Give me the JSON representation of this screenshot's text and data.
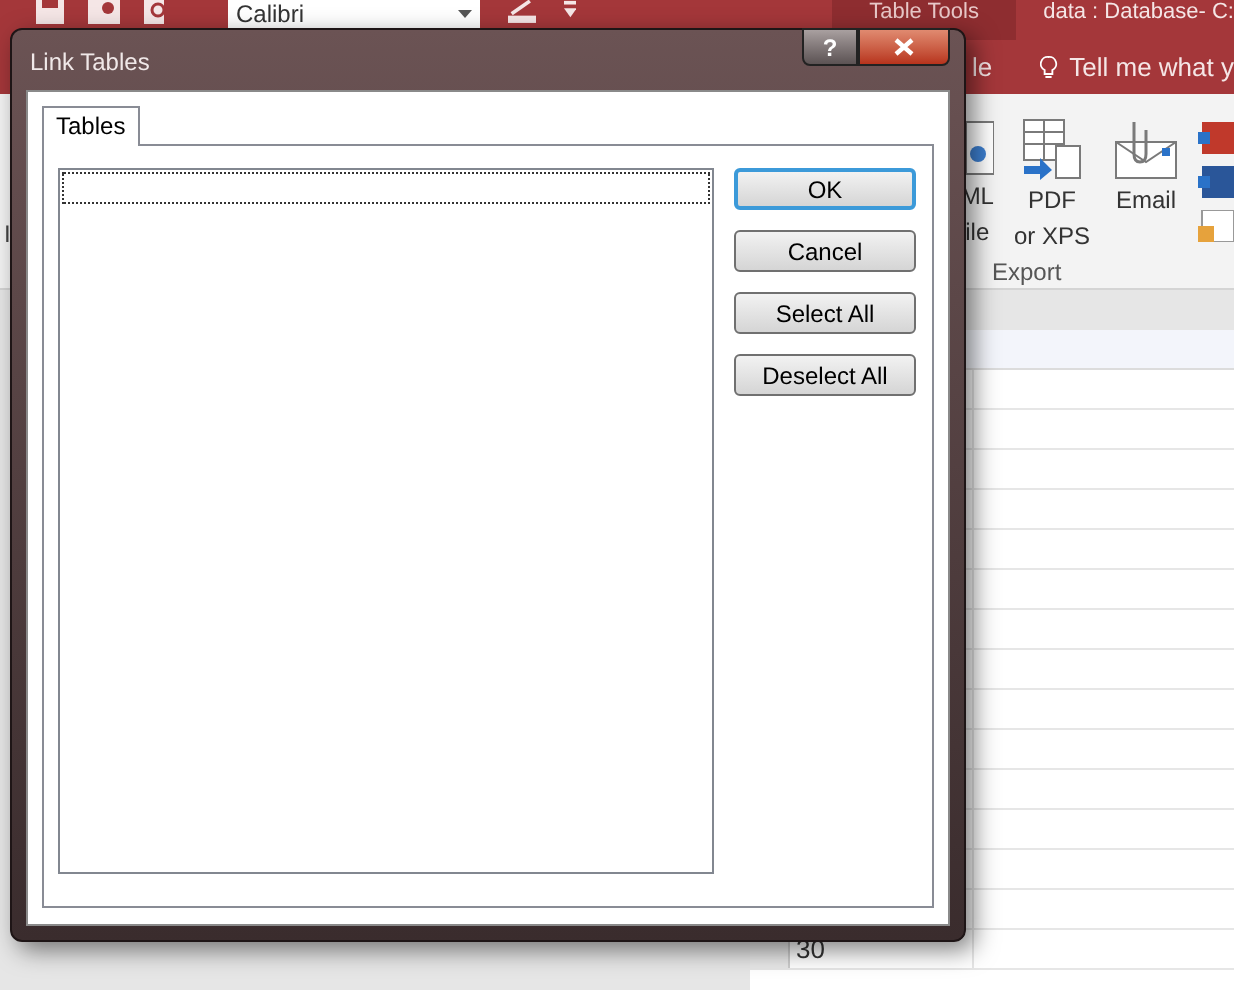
{
  "app": {
    "font_box": "Calibri",
    "context_tab": "Table Tools",
    "title": "data : Database- C:",
    "ribbon_tab": "le",
    "tell_me": "Tell me what y",
    "left_label": "I",
    "export_group": {
      "label": "Export",
      "commands": [
        {
          "kind": "xml",
          "lines": [
            "ML",
            "ile"
          ]
        },
        {
          "kind": "pdf",
          "lines": [
            "PDF",
            "or XPS"
          ]
        },
        {
          "kind": "email",
          "lines": [
            "Email"
          ]
        }
      ]
    },
    "grid": {
      "row_numbers": [
        "30"
      ]
    }
  },
  "dialog": {
    "title": "Link Tables",
    "help_label": "?",
    "tabs": [
      {
        "label": "Tables",
        "selected": true
      }
    ],
    "buttons": [
      {
        "label": "OK",
        "default": true
      },
      {
        "label": "Cancel",
        "default": false
      },
      {
        "label": "Select All",
        "default": false
      },
      {
        "label": "Deselect All",
        "default": false
      }
    ]
  }
}
